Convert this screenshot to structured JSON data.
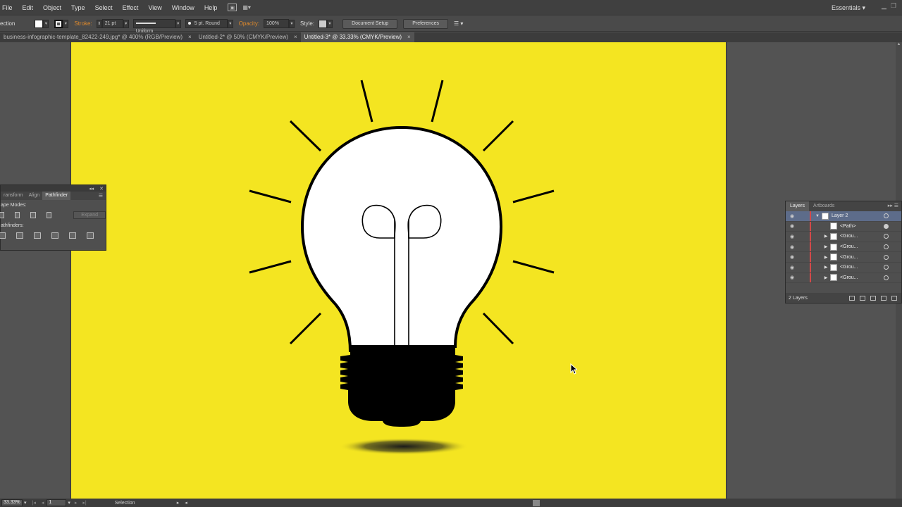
{
  "menu": [
    "File",
    "Edit",
    "Object",
    "Type",
    "Select",
    "Effect",
    "View",
    "Window",
    "Help"
  ],
  "workspace": "Essentials",
  "control": {
    "tool": "ection",
    "stroke_label": "Stroke:",
    "stroke_weight": "21 pt",
    "profile": "Uniform",
    "brush": "5 pt. Round",
    "opacity_label": "Opacity:",
    "opacity": "100%",
    "style_label": "Style:",
    "doc_setup": "Document Setup",
    "preferences": "Preferences"
  },
  "tabs": [
    {
      "label": "business-infographic-template_82422-249.jpg* @ 400% (RGB/Preview)",
      "close": "×"
    },
    {
      "label": "Untitled-2* @ 50% (CMYK/Preview)",
      "close": "×"
    },
    {
      "label": "Untitled-3* @ 33.33% (CMYK/Preview)",
      "close": "×"
    }
  ],
  "pathfinder": {
    "tabs": [
      "ransform",
      "Align",
      "Pathfinder"
    ],
    "shape_modes": "ape Modes:",
    "expand": "Expand",
    "pathfinders": "athfinders:"
  },
  "layers": {
    "tabs": [
      "Layers",
      "Artboards"
    ],
    "rows": [
      {
        "name": "Layer 2",
        "tri": "▼",
        "selected": true
      },
      {
        "name": "<Path>",
        "tri": "",
        "selected": false
      },
      {
        "name": "<Grou...",
        "tri": "▶",
        "selected": false
      },
      {
        "name": "<Grou...",
        "tri": "▶",
        "selected": false
      },
      {
        "name": "<Grou...",
        "tri": "▶",
        "selected": false
      },
      {
        "name": "<Grou...",
        "tri": "▶",
        "selected": false
      },
      {
        "name": "<Grou...",
        "tri": "▶",
        "selected": false
      }
    ],
    "count": "2 Layers"
  },
  "status": {
    "zoom": "33.33%",
    "page": "1",
    "tool": "Selection"
  },
  "colors": {
    "artboard": "#f4e521",
    "ink": "#000000",
    "bulb": "#ffffff"
  }
}
